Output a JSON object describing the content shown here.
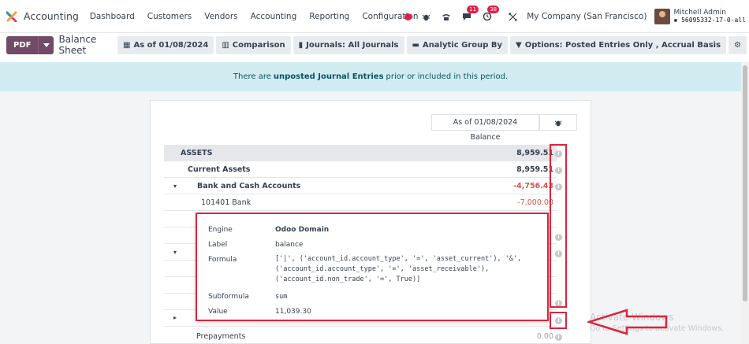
{
  "nav": {
    "app_name": "Accounting",
    "menu": [
      "Dashboard",
      "Customers",
      "Vendors",
      "Accounting",
      "Reporting",
      "Configuration"
    ],
    "messages_badge": "11",
    "activity_badge": "38",
    "company": "My Company (San Francisco)",
    "user_name": "Mitchell Admin",
    "database": "56095332-17-0-all"
  },
  "control": {
    "pdf_label": "PDF",
    "breadcrumb": "Balance Sheet",
    "filters": [
      {
        "icon": "calendar-icon",
        "label": "As of 01/08/2024"
      },
      {
        "icon": "bar-chart-icon",
        "label": "Comparison"
      },
      {
        "icon": "book-icon",
        "label": "Journals: All Journals"
      },
      {
        "icon": "folder-icon",
        "label": "Analytic Group By"
      },
      {
        "icon": "filter-icon",
        "label": "Options: Posted Entries Only , Accrual Basis"
      }
    ]
  },
  "banner": {
    "prefix": "There are",
    "bold": "unposted Journal Entries",
    "suffix": "prior or included in this period."
  },
  "report": {
    "column_date": "As of 01/08/2024",
    "column_balance": "Balance",
    "rows": [
      {
        "name": "ASSETS",
        "value": "8,959.51"
      },
      {
        "name": "Current Assets",
        "value": "8,959.51"
      },
      {
        "name": "Bank and Cash Accounts",
        "value": "-4,756.43"
      },
      {
        "name": "101401 Bank",
        "value": "-7,000.00"
      },
      {
        "name": "Prepayments",
        "value": "0.00"
      }
    ]
  },
  "popup": {
    "engine_label": "Engine",
    "engine_value": "Odoo Domain",
    "label_label": "Label",
    "label_value": "balance",
    "formula_label": "Formula",
    "formula_value": "['|', ('account_id.account_type', '=', 'asset_current'), '&',\n('account_id.account_type', '=', 'asset_receivable'),\n('account_id.non_trade', '=', True)]",
    "subformula_label": "Subformula",
    "subformula_value": "sum",
    "value_label": "Value",
    "value_value": "11,039.30"
  },
  "watermark": {
    "title": "Activate Windows",
    "subtitle": "Go to Settings to activate Windows."
  },
  "colors": {
    "brand": "#714b67",
    "highlight_red": "#d7263d",
    "banner_bg": "#d1ecf1",
    "negative": "#d9534f"
  }
}
